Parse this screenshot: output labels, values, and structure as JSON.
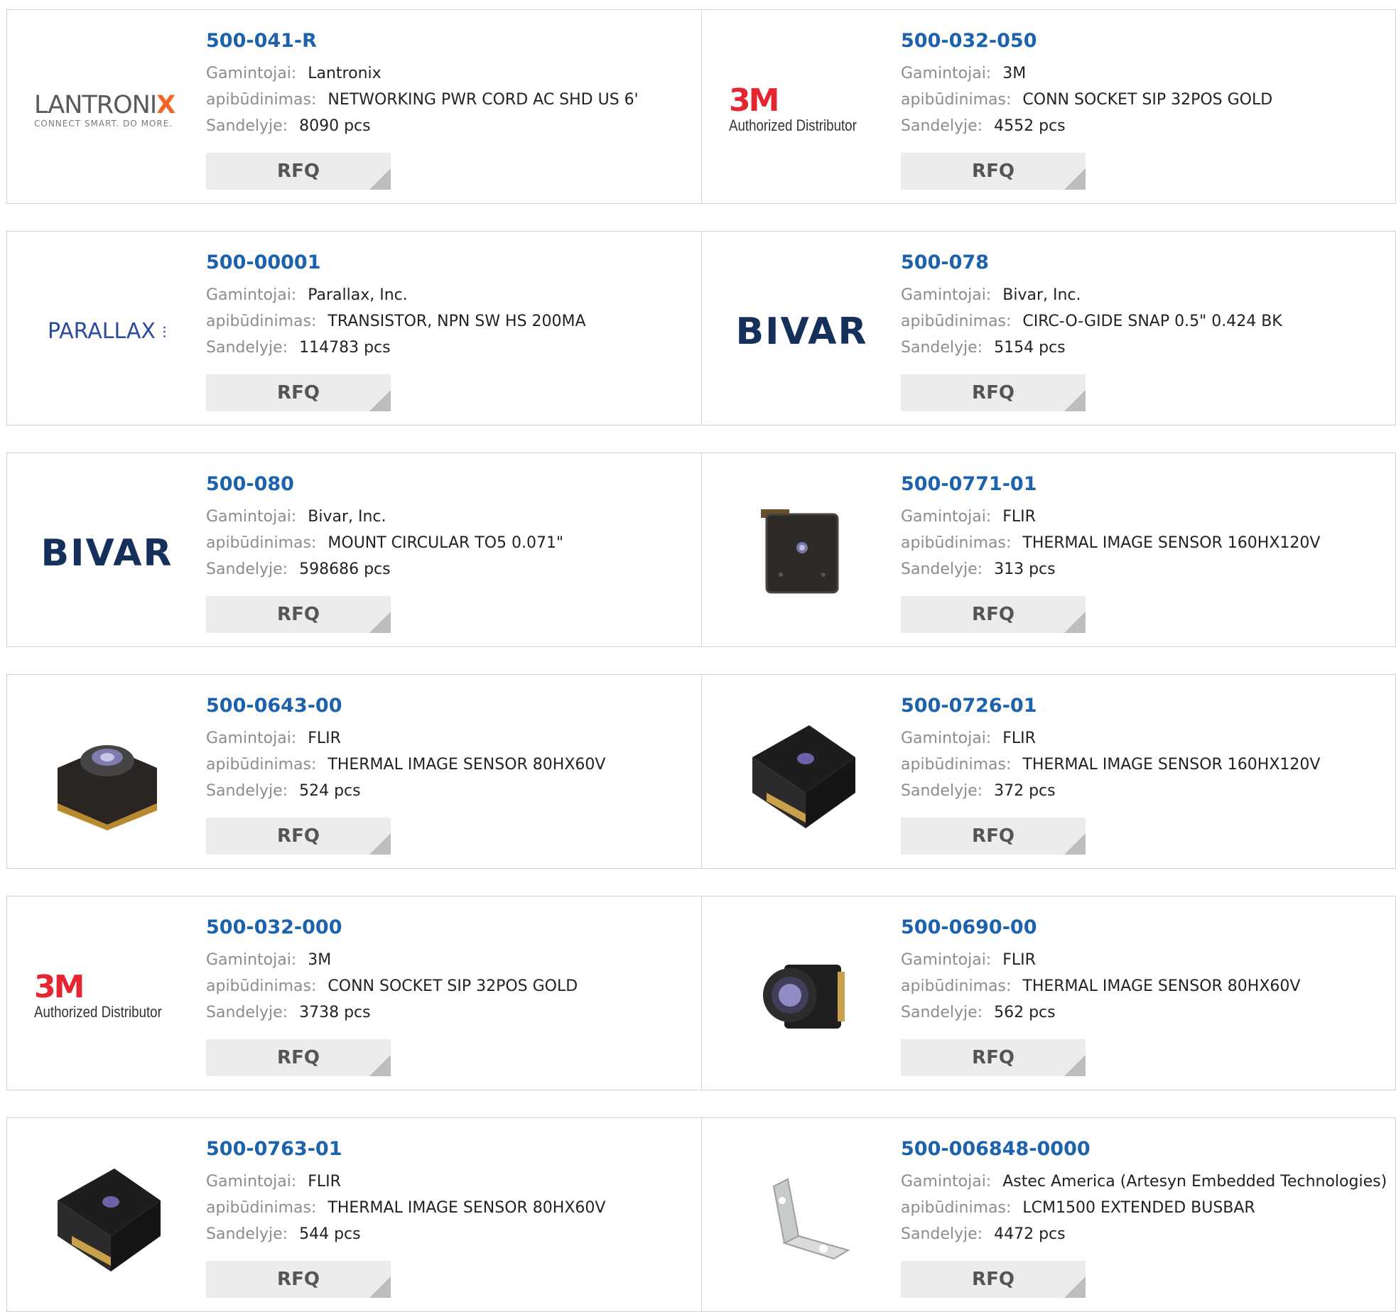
{
  "labels": {
    "manufacturer": "Gamintojai:",
    "description": "apibūdinimas:",
    "stock": "Sandelyje:",
    "rfq": "RFQ"
  },
  "colors": {
    "part_number_link": "#1d62ad",
    "label_grey": "#8c8c8c",
    "button_bg": "#ececec"
  },
  "products": [
    {
      "part": "500-041-R",
      "manufacturer": "Lantronix",
      "description": "NETWORKING PWR CORD AC SHD US 6'",
      "stock": "8090 pcs",
      "logo": "lantronix-logo"
    },
    {
      "part": "500-032-050",
      "manufacturer": "3M",
      "description": "CONN SOCKET SIP 32POS GOLD",
      "stock": "4552 pcs",
      "logo": "3m-logo"
    },
    {
      "part": "500-00001",
      "manufacturer": "Parallax, Inc.",
      "description": "TRANSISTOR, NPN SW HS 200MA",
      "stock": "114783 pcs",
      "logo": "parallax-logo"
    },
    {
      "part": "500-078",
      "manufacturer": "Bivar, Inc.",
      "description": "CIRC-O-GIDE SNAP 0.5\" 0.424 BK",
      "stock": "5154 pcs",
      "logo": "bivar-logo"
    },
    {
      "part": "500-080",
      "manufacturer": "Bivar, Inc.",
      "description": "MOUNT CIRCULAR TO5 0.071\"",
      "stock": "598686 pcs",
      "logo": "bivar-logo"
    },
    {
      "part": "500-0771-01",
      "manufacturer": "FLIR",
      "description": "THERMAL IMAGE SENSOR 160HX120V",
      "stock": "313 pcs",
      "logo": "sensor-flat-photo"
    },
    {
      "part": "500-0643-00",
      "manufacturer": "FLIR",
      "description": "THERMAL IMAGE SENSOR 80HX60V",
      "stock": "524 pcs",
      "logo": "sensor-module-photo"
    },
    {
      "part": "500-0726-01",
      "manufacturer": "FLIR",
      "description": "THERMAL IMAGE SENSOR 160HX120V",
      "stock": "372 pcs",
      "logo": "sensor-angled-photo"
    },
    {
      "part": "500-032-000",
      "manufacturer": "3M",
      "description": "CONN SOCKET SIP 32POS GOLD",
      "stock": "3738 pcs",
      "logo": "3m-logo"
    },
    {
      "part": "500-0690-00",
      "manufacturer": "FLIR",
      "description": "THERMAL IMAGE SENSOR 80HX60V",
      "stock": "562 pcs",
      "logo": "sensor-lens-photo"
    },
    {
      "part": "500-0763-01",
      "manufacturer": "FLIR",
      "description": "THERMAL IMAGE SENSOR 80HX60V",
      "stock": "544 pcs",
      "logo": "sensor-angled-photo"
    },
    {
      "part": "500-006848-0000",
      "manufacturer": "Astec America (Artesyn Embedded Technologies)",
      "description": "LCM1500 EXTENDED BUSBAR",
      "stock": "4472 pcs",
      "logo": "busbar-photo"
    }
  ],
  "logos": {
    "lantronix": {
      "main": "LANTRONI",
      "x": "X",
      "sub": "CONNECT SMART. DO MORE."
    },
    "three_m": {
      "brand": "3M",
      "sub": "Authorized Distributor"
    },
    "parallax": {
      "text": "PARALLAX"
    },
    "bivar": {
      "text": "BIVAR"
    }
  }
}
